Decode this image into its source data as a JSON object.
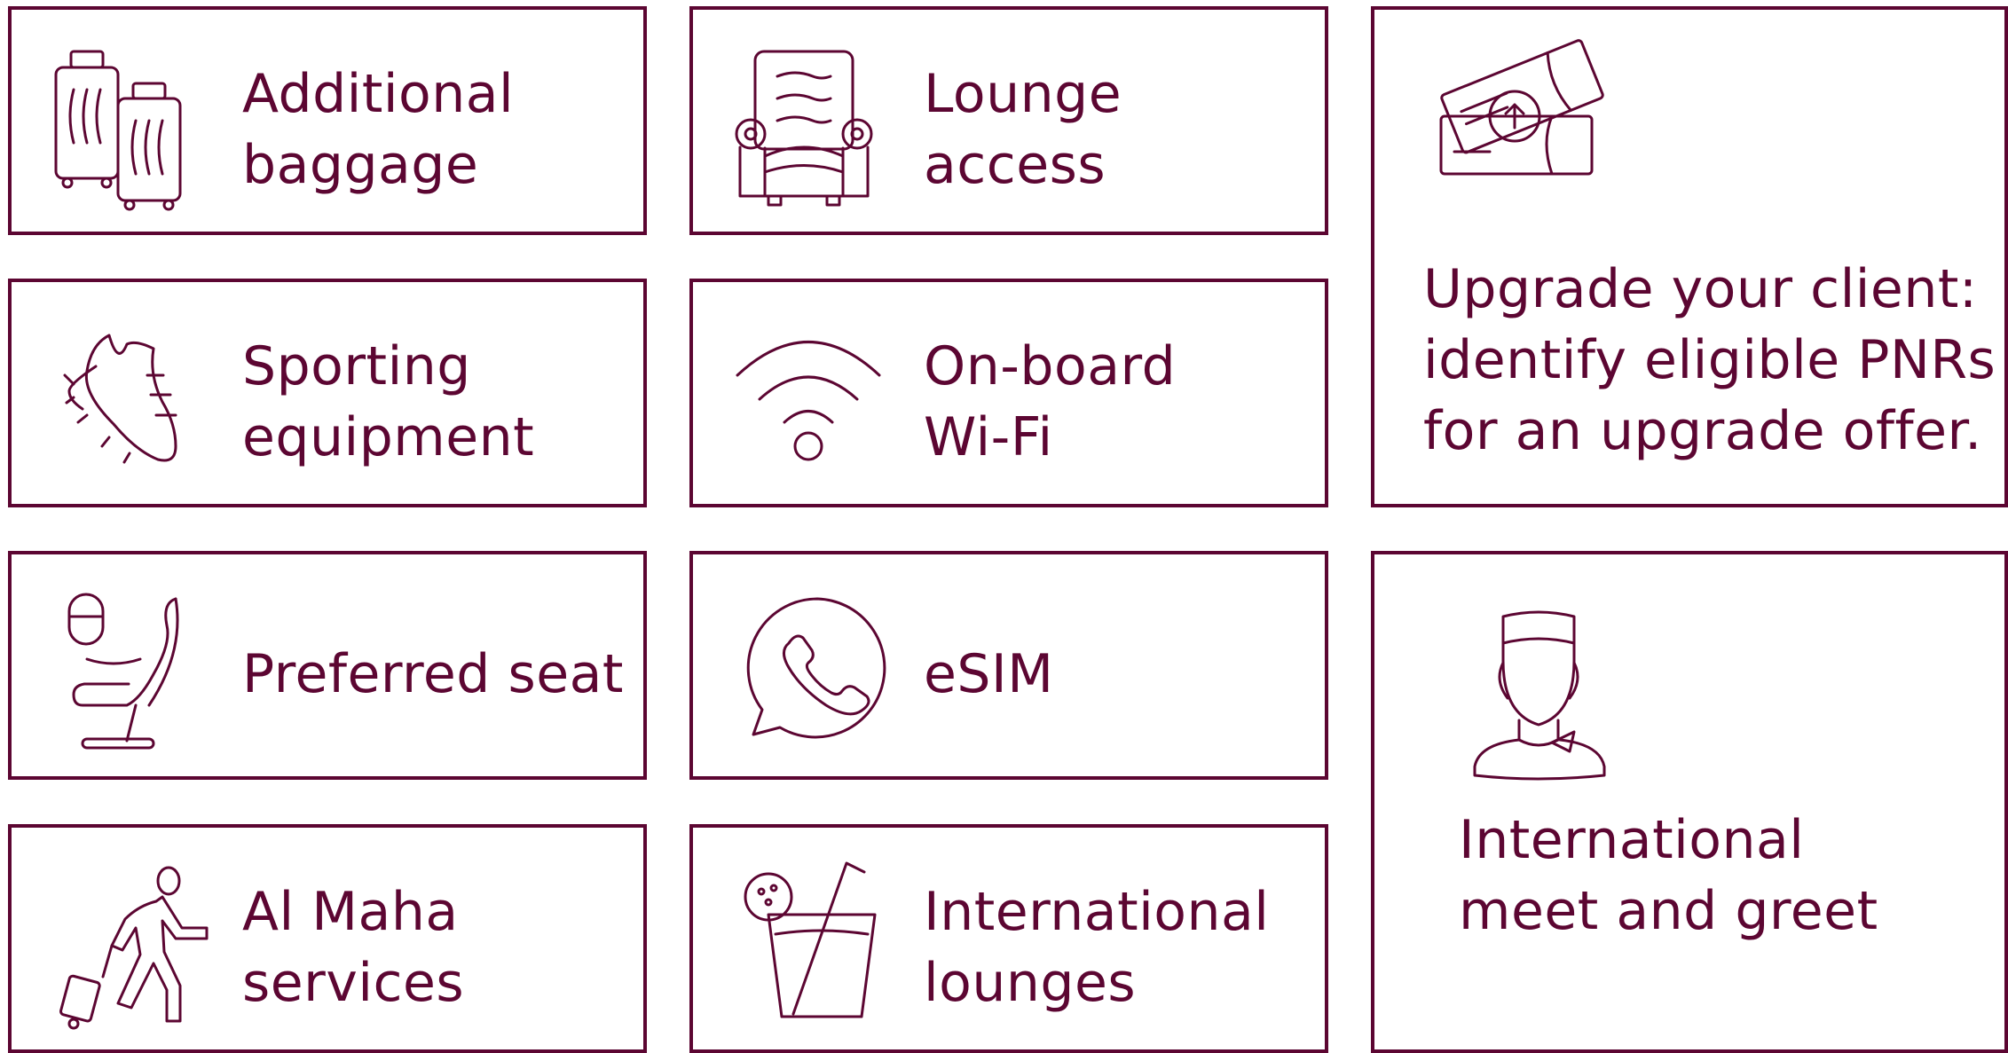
{
  "tiles": [
    {
      "lines": [
        "Additional",
        "baggage"
      ],
      "icon": "luggage-icon"
    },
    {
      "lines": [
        "Lounge",
        "access"
      ],
      "icon": "armchair-icon"
    },
    {
      "lines": [
        "Sporting",
        "equipment"
      ],
      "icon": "sports-shoe-icon"
    },
    {
      "lines": [
        "On-board",
        "Wi-Fi"
      ],
      "icon": "wifi-icon"
    },
    {
      "lines": [
        "Preferred seat"
      ],
      "icon": "airplane-seat-icon"
    },
    {
      "lines": [
        "eSIM"
      ],
      "icon": "chat-phone-icon"
    },
    {
      "lines": [
        "Al Maha",
        "services"
      ],
      "icon": "traveler-with-suitcase-icon"
    },
    {
      "lines": [
        "International",
        "lounges"
      ],
      "icon": "drink-cup-icon"
    }
  ],
  "upgrade": {
    "lines": [
      "Upgrade your client:",
      "identify eligible PNRs",
      "for an upgrade offer."
    ],
    "icon": "upgrade-ticket-icon"
  },
  "meet": {
    "lines": [
      "International",
      "meet and greet"
    ],
    "icon": "cabin-crew-icon"
  },
  "colors": {
    "brand": "#5c0632",
    "background": "#ffffff"
  }
}
